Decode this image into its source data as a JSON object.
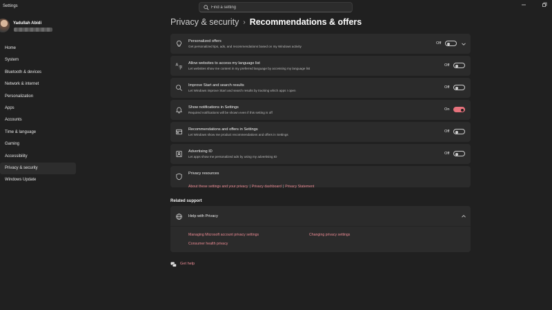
{
  "window": {
    "title": "Settings"
  },
  "search": {
    "placeholder": "Find a setting"
  },
  "profile": {
    "name": "Yadullah Abidi"
  },
  "sidebar": {
    "items": [
      {
        "label": "Home"
      },
      {
        "label": "System"
      },
      {
        "label": "Bluetooth & devices"
      },
      {
        "label": "Network & internet"
      },
      {
        "label": "Personalization"
      },
      {
        "label": "Apps"
      },
      {
        "label": "Accounts"
      },
      {
        "label": "Time & language"
      },
      {
        "label": "Gaming"
      },
      {
        "label": "Accessibility"
      },
      {
        "label": "Privacy & security",
        "active": true
      },
      {
        "label": "Windows Update"
      }
    ]
  },
  "breadcrumb": {
    "parent": "Privacy & security",
    "separator": "›",
    "current": "Recommendations & offers"
  },
  "settings": [
    {
      "icon": "lightbulb-icon",
      "title": "Personalized offers",
      "desc": "Get personalized tips, ads, and recommendations based on my Windows activity",
      "state": "Off",
      "on": false,
      "expand": true
    },
    {
      "icon": "language-icon",
      "title": "Allow websites to access my language list",
      "desc": "Let websites show me content in my preferred language by accessing my language list",
      "state": "Off",
      "on": false
    },
    {
      "icon": "search-icon",
      "title": "Improve Start and search results",
      "desc": "Let Windows improve Start and search results by tracking which apps I open",
      "state": "Off",
      "on": false
    },
    {
      "icon": "bell-icon",
      "title": "Show notifications in Settings",
      "desc": "Required notifications will be shown even if this setting is off",
      "state": "On",
      "on": true
    },
    {
      "icon": "recommendations-icon",
      "title": "Recommendations and offers in Settings",
      "desc": "Let Windows show me product recommendations and offers in Settings",
      "state": "Off",
      "on": false
    },
    {
      "icon": "advertising-id-icon",
      "title": "Advertising ID",
      "desc": "Let apps show me personalized ads by using my advertising ID",
      "state": "Off",
      "on": false
    }
  ],
  "privacy_resources": {
    "title": "Privacy resources",
    "links": [
      "About these settings and your privacy",
      "Privacy dashboard",
      "Privacy Statement"
    ],
    "separator": "|"
  },
  "related_support": {
    "label": "Related support",
    "help_title": "Help with Privacy",
    "links": [
      "Managing Microsoft account privacy settings",
      "Changing privacy settings",
      "Consumer health privacy"
    ]
  },
  "get_help": {
    "label": "Get help"
  },
  "colors": {
    "background": "#202020",
    "card": "#2b2b2b",
    "accent": "#e6727c",
    "link": "#ec8b94"
  }
}
